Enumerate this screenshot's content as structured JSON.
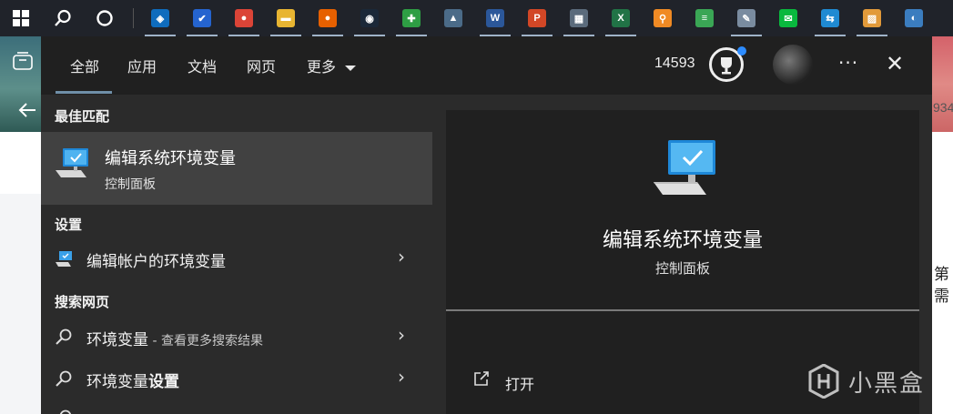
{
  "taskbar": {
    "apps": [
      {
        "icon": "shield-app-icon",
        "color": "#0f6cbd",
        "glyph": "◈"
      },
      {
        "icon": "todo-check-icon",
        "color": "#2564cf",
        "glyph": "✔"
      },
      {
        "icon": "chrome-icon",
        "color": "#db4437",
        "glyph": "●"
      },
      {
        "icon": "file-explorer-icon",
        "color": "#e8b532",
        "glyph": "▬"
      },
      {
        "icon": "firefox-icon",
        "color": "#e66000",
        "glyph": "●"
      },
      {
        "icon": "steam-icon",
        "color": "#1b2838",
        "glyph": "◉"
      },
      {
        "icon": "game-app-icon",
        "color": "#2e9e44",
        "glyph": "✚"
      },
      {
        "icon": "photos-icon",
        "color": "#4b6b88",
        "glyph": "▲"
      },
      {
        "icon": "word-icon",
        "color": "#2b579a",
        "glyph": "W"
      },
      {
        "icon": "powerpoint-icon",
        "color": "#d24726",
        "glyph": "P"
      },
      {
        "icon": "calculator-icon",
        "color": "#5b6b7c",
        "glyph": "▦"
      },
      {
        "icon": "excel-icon",
        "color": "#217346",
        "glyph": "X"
      },
      {
        "icon": "search-app-icon",
        "color": "#f08a24",
        "glyph": "⚲"
      },
      {
        "icon": "notes-app-icon",
        "color": "#3aa655",
        "glyph": "≡"
      },
      {
        "icon": "paint-icon",
        "color": "#7a8ca0",
        "glyph": "✎"
      },
      {
        "icon": "wechat-icon",
        "color": "#09b83e",
        "glyph": "✉"
      },
      {
        "icon": "transfer-app-icon",
        "color": "#1f8ad2",
        "glyph": "⇆"
      },
      {
        "icon": "image-viewer-icon",
        "color": "#e29a3a",
        "glyph": "▨"
      },
      {
        "icon": "browser-app-icon",
        "color": "#3b7dbf",
        "glyph": "◐"
      }
    ],
    "active_app_indices": [
      0,
      1,
      2,
      3,
      4,
      5,
      6,
      8,
      9,
      10,
      11,
      14,
      16,
      17
    ]
  },
  "search": {
    "tabs": [
      "全部",
      "应用",
      "文档",
      "网页",
      "更多"
    ],
    "rewards_points": "14593"
  },
  "results": {
    "best_match_title": "最佳匹配",
    "best_match": {
      "title": "编辑系统环境变量",
      "subtitle": "控制面板"
    },
    "settings_title": "设置",
    "settings_item": "编辑帐户的环境变量",
    "web_title": "搜索网页",
    "web_items": [
      {
        "main": "环境变量",
        "suffix": " - 查看更多搜索结果"
      },
      {
        "main": "环境变量",
        "bold": "设置"
      }
    ]
  },
  "preview": {
    "title": "编辑系统环境变量",
    "subtitle": "控制面板",
    "open_label": "打开"
  },
  "background": {
    "partial_number": "934",
    "chars": [
      "第",
      "需"
    ]
  },
  "watermark": {
    "text": "小黑盒"
  }
}
